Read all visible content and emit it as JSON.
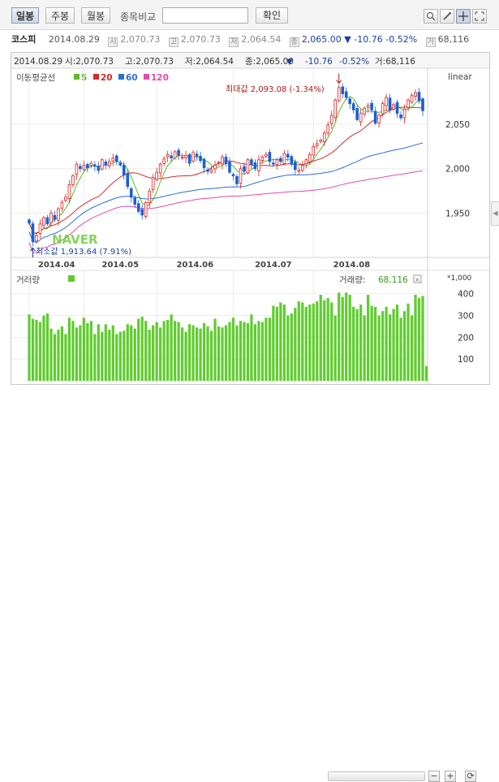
{
  "toolbar": {
    "tabs": [
      "일봉",
      "주봉",
      "월봉"
    ],
    "compare_label": "종목비교",
    "confirm_label": "확인",
    "tool_icons": [
      "magnifier-icon",
      "pencil-icon",
      "crosshair-icon",
      "expand-icon"
    ]
  },
  "quote": {
    "name": "코스피",
    "date": "2014.08.29",
    "open_icon": "시",
    "open": "2,070.73",
    "high_icon": "고",
    "high": "2,070.73",
    "low_icon": "저",
    "low": "2,064.54",
    "close_icon": "종",
    "close": "2,065.00",
    "change_arrow": "▼",
    "change": "-10.76",
    "change_pct": "-0.52%",
    "volume_icon": "거",
    "volume": "68,116"
  },
  "chart": {
    "info_date": "2014.08.29",
    "info_open": "시:2,070.73",
    "info_high": "고:2,070.73",
    "info_low": "저:2,064.54",
    "info_close": "종:2,065.00",
    "info_arrow": "▼",
    "info_change": "-10.76",
    "info_pct": "-0.52%",
    "info_vol": "거:68,116",
    "ma_label": "이동평균선",
    "scale_label": "linear",
    "max_label": "최대값 2,093.08 (-1.34%)",
    "min_label": "최소값 1,913.64 (7.91%)",
    "watermark": "NAVER",
    "volume_label": "거래량",
    "volume_value_label": "거래량:",
    "volume_value": "68,116",
    "volume_unit": "*1,000",
    "colors": {
      "up": "#e02020",
      "down": "#1a5fd6",
      "ma5": "#5cb82a",
      "ma20": "#d42a2a",
      "ma60": "#2a6fd4",
      "ma120": "#e04bb0",
      "volume": "#5fcc2e"
    }
  },
  "chart_data": {
    "type": "candlestick",
    "xlabel": "",
    "ylabel": "",
    "x_ticks": [
      "2014.04",
      "2014.05",
      "2014.06",
      "2014.07",
      "2014.08"
    ],
    "y_ticks": [
      1950,
      2000,
      2050
    ],
    "ylim": [
      1905,
      2110
    ],
    "volume_ticks": [
      100,
      200,
      300,
      400
    ],
    "volume_ylim": [
      0,
      440
    ],
    "ma_series": [
      {
        "name": "5",
        "color": "#5cb82a"
      },
      {
        "name": "20",
        "color": "#d42a2a"
      },
      {
        "name": "60",
        "color": "#2a6fd4"
      },
      {
        "name": "120",
        "color": "#e04bb0"
      }
    ],
    "first_month_index": [
      0,
      15,
      35,
      56,
      78,
      99
    ],
    "closes": [
      1939,
      1918,
      1925,
      1938,
      1945,
      1938,
      1950,
      1943,
      1955,
      1962,
      1968,
      1982,
      1992,
      2005,
      2000,
      2004,
      2001,
      2006,
      2003,
      1998,
      2010,
      2004,
      2008,
      2012,
      2008,
      2004,
      1993,
      1980,
      1968,
      1960,
      1952,
      1948,
      1962,
      1975,
      1990,
      1996,
      2005,
      2011,
      2016,
      2012,
      2019,
      2015,
      2013,
      2015,
      2006,
      2018,
      2014,
      2009,
      2001,
      1997,
      1999,
      2004,
      2007,
      2013,
      2006,
      1996,
      1992,
      1983,
      2000,
      1997,
      2010,
      2005,
      2000,
      2010,
      2013,
      2016,
      2008,
      2005,
      2010,
      2008,
      2017,
      2013,
      2005,
      1999,
      1998,
      2004,
      2010,
      2016,
      2025,
      2028,
      2032,
      2040,
      2049,
      2060,
      2077,
      2091,
      2084,
      2080,
      2073,
      2066,
      2055,
      2062,
      2068,
      2071,
      2066,
      2051,
      2060,
      2073,
      2080,
      2066,
      2072,
      2062,
      2057,
      2067,
      2077,
      2082,
      2085,
      2076,
      2065
    ],
    "volumes": [
      305,
      285,
      280,
      270,
      300,
      310,
      240,
      215,
      235,
      250,
      215,
      290,
      275,
      245,
      255,
      290,
      265,
      275,
      215,
      260,
      225,
      260,
      235,
      255,
      215,
      225,
      230,
      260,
      255,
      240,
      285,
      295,
      275,
      235,
      255,
      270,
      245,
      275,
      280,
      305,
      275,
      270,
      245,
      225,
      260,
      255,
      245,
      240,
      265,
      250,
      230,
      285,
      250,
      245,
      255,
      270,
      290,
      255,
      275,
      270,
      265,
      305,
      260,
      275,
      270,
      290,
      290,
      345,
      340,
      360,
      350,
      300,
      310,
      335,
      365,
      360,
      340,
      350,
      355,
      365,
      395,
      370,
      380,
      360,
      300,
      405,
      385,
      405,
      395,
      340,
      330,
      350,
      300,
      395,
      345,
      340,
      300,
      320,
      340,
      305,
      330,
      350,
      290,
      320,
      355,
      300,
      395,
      380,
      390,
      68
    ]
  }
}
